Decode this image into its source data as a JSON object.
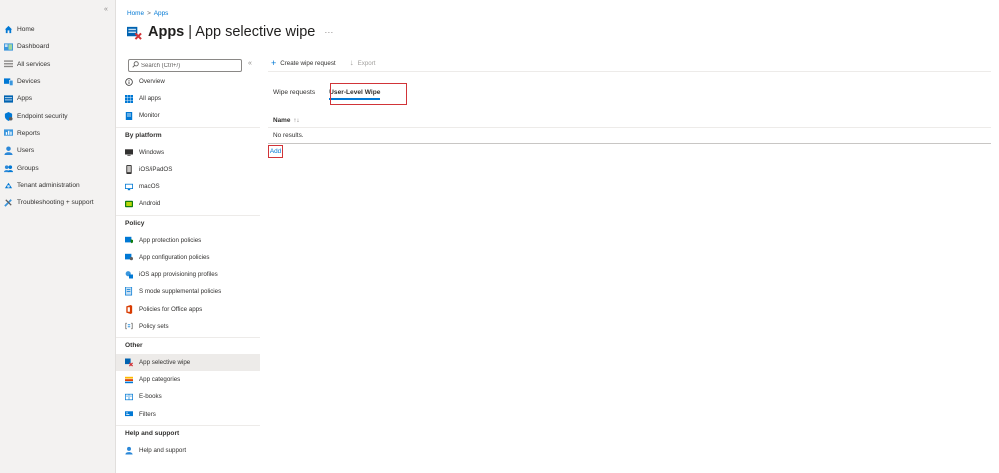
{
  "nav": {
    "items": [
      {
        "label": "Home",
        "icon": "home-icon",
        "color": "#0078d4"
      },
      {
        "label": "Dashboard",
        "icon": "dashboard-icon",
        "color": "#3a96dd"
      },
      {
        "label": "All services",
        "icon": "list-icon",
        "color": "#8a8886"
      },
      {
        "label": "Devices",
        "icon": "devices-icon",
        "color": "#0078d4"
      },
      {
        "label": "Apps",
        "icon": "apps-icon",
        "color": "#0063b1"
      },
      {
        "label": "Endpoint security",
        "icon": "shield-icon",
        "color": "#0078d4"
      },
      {
        "label": "Reports",
        "icon": "reports-icon",
        "color": "#3a96dd"
      },
      {
        "label": "Users",
        "icon": "user-icon",
        "color": "#2b88d8"
      },
      {
        "label": "Groups",
        "icon": "groups-icon",
        "color": "#2b88d8"
      },
      {
        "label": "Tenant administration",
        "icon": "tenant-icon",
        "color": "#0078d4"
      },
      {
        "label": "Troubleshooting + support",
        "icon": "tools-icon",
        "color": "#3a96dd"
      }
    ]
  },
  "breadcrumb": {
    "home": "Home",
    "sep": ">",
    "apps": "Apps"
  },
  "title": {
    "main": "Apps",
    "sep": " | ",
    "sub": "App selective wipe",
    "more": "···"
  },
  "search": {
    "placeholder": "Search (Ctrl+/)",
    "collapse": "«"
  },
  "menu": {
    "top": [
      {
        "label": "Overview",
        "icon": "info-icon"
      },
      {
        "label": "All apps",
        "icon": "grid-icon"
      },
      {
        "label": "Monitor",
        "icon": "monitor-icon"
      }
    ],
    "platform_title": "By platform",
    "platform": [
      {
        "label": "Windows",
        "icon": "windows-icon"
      },
      {
        "label": "iOS/iPadOS",
        "icon": "phone-icon"
      },
      {
        "label": "macOS",
        "icon": "mac-icon"
      },
      {
        "label": "Android",
        "icon": "android-icon"
      }
    ],
    "policy_title": "Policy",
    "policy": [
      {
        "label": "App protection policies",
        "icon": "protection-icon"
      },
      {
        "label": "App configuration policies",
        "icon": "config-icon"
      },
      {
        "label": "iOS app provisioning profiles",
        "icon": "profile-icon"
      },
      {
        "label": "S mode supplemental policies",
        "icon": "document-icon"
      },
      {
        "label": "Policies for Office apps",
        "icon": "office-icon"
      },
      {
        "label": "Policy sets",
        "icon": "brackets-icon"
      }
    ],
    "other_title": "Other",
    "other": [
      {
        "label": "App selective wipe",
        "icon": "wipe-icon"
      },
      {
        "label": "App categories",
        "icon": "categories-icon"
      },
      {
        "label": "E-books",
        "icon": "book-icon"
      },
      {
        "label": "Filters",
        "icon": "filter-icon"
      }
    ],
    "help_title": "Help and support",
    "help": [
      {
        "label": "Help and support",
        "icon": "help-user-icon"
      }
    ]
  },
  "toolbar": {
    "create_label": "Create wipe request",
    "export_label": "Export"
  },
  "tabs": [
    {
      "label": "Wipe requests"
    },
    {
      "label": "User-Level Wipe"
    }
  ],
  "list": {
    "column": "Name",
    "sort_glyph": "↑↓",
    "empty": "No results."
  },
  "add_label": "Add",
  "colors": {
    "accent": "#0078d4",
    "highlight": "#d13438"
  }
}
